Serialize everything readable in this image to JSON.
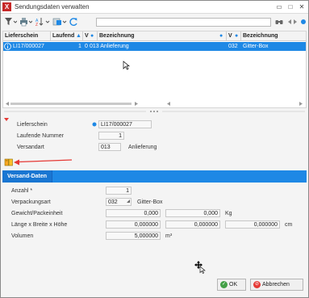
{
  "window": {
    "title": "Sendungsdaten verwalten",
    "app_icon_letter": "X"
  },
  "titlebar_buttons": [
    "▭",
    "□",
    "✕"
  ],
  "toolbar": {
    "search_value": ""
  },
  "grid": {
    "columns": [
      "Lieferschein",
      "Laufend",
      "V",
      "Bezeichnung",
      "V",
      "Bezeichnung"
    ],
    "rows": [
      {
        "lieferschein": "LI17/000027",
        "laufend": "1",
        "v1": "0",
        "bez1": "013 Anlieferung",
        "v2": "032",
        "bez2": "Gitter-Box"
      }
    ]
  },
  "header_form": {
    "lieferschein_label": "Lieferschein",
    "lieferschein_value": "LI17/000027",
    "laufende_nummer_label": "Laufende Nummer",
    "laufende_nummer_value": "1",
    "versandart_label": "Versandart",
    "versandart_code": "013",
    "versandart_text": "Anlieferung"
  },
  "tabs": {
    "active": "Versand-Daten"
  },
  "detail_form": {
    "anzahl_label": "Anzahl *",
    "anzahl_value": "1",
    "verpackungsart_label": "Verpackungsart",
    "verpackungsart_code": "032",
    "verpackungsart_text": "Gitter-Box",
    "gewicht_label": "Gewicht/Packeinheit",
    "gewicht_value1": "0,000",
    "gewicht_value2": "0,000",
    "gewicht_unit": "Kg",
    "lbh_label": "Länge x Breite x Höhe",
    "lbh_l": "0,000000",
    "lbh_b": "0,000000",
    "lbh_h": "0,000000",
    "lbh_unit": "cm",
    "volumen_label": "Volumen",
    "volumen_value": "5,000000",
    "volumen_unit": "m³"
  },
  "footer": {
    "ok_label": "OK",
    "cancel_label": "Abbrechen"
  },
  "colors": {
    "accent": "#1e88e5",
    "ok_green": "#43a047",
    "cancel_red": "#e53935",
    "arrow_red": "#e53935"
  }
}
